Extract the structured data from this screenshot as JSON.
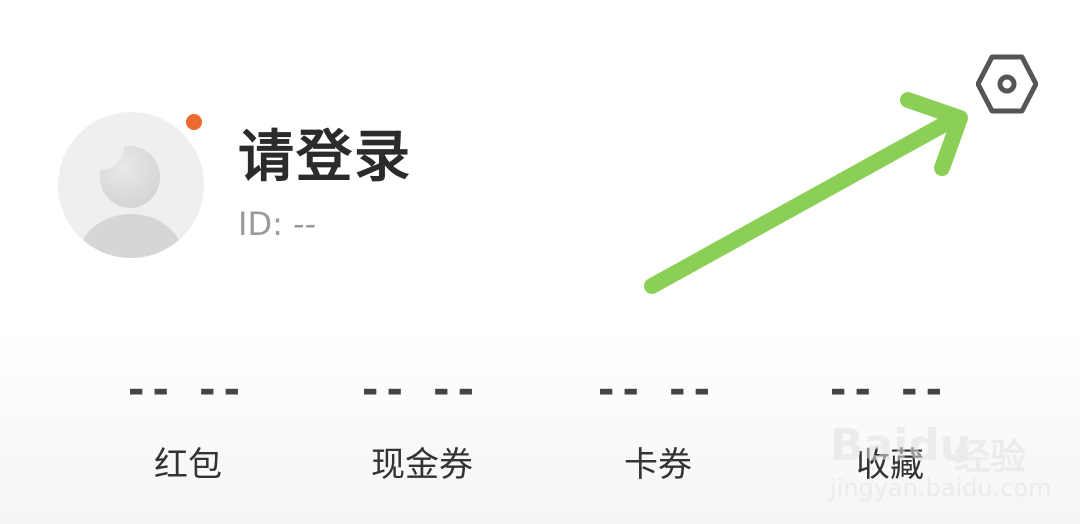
{
  "profile": {
    "title": "请登录",
    "id_text": "ID: --"
  },
  "stats": [
    {
      "value": "-- --",
      "label": "红包"
    },
    {
      "value": "-- --",
      "label": "现金券"
    },
    {
      "value": "-- --",
      "label": "卡券"
    },
    {
      "value": "-- --",
      "label": "收藏"
    }
  ],
  "icons": {
    "settings": "settings-hexagon-icon",
    "avatar": "default-avatar-icon",
    "arrow": "annotation-arrow"
  },
  "watermark": {
    "brand": "Baidu",
    "cn": "经验",
    "url": "jingyan.baidu.com"
  },
  "colors": {
    "notification_dot": "#ee6a2e",
    "annotation_arrow": "#8ccf56"
  }
}
